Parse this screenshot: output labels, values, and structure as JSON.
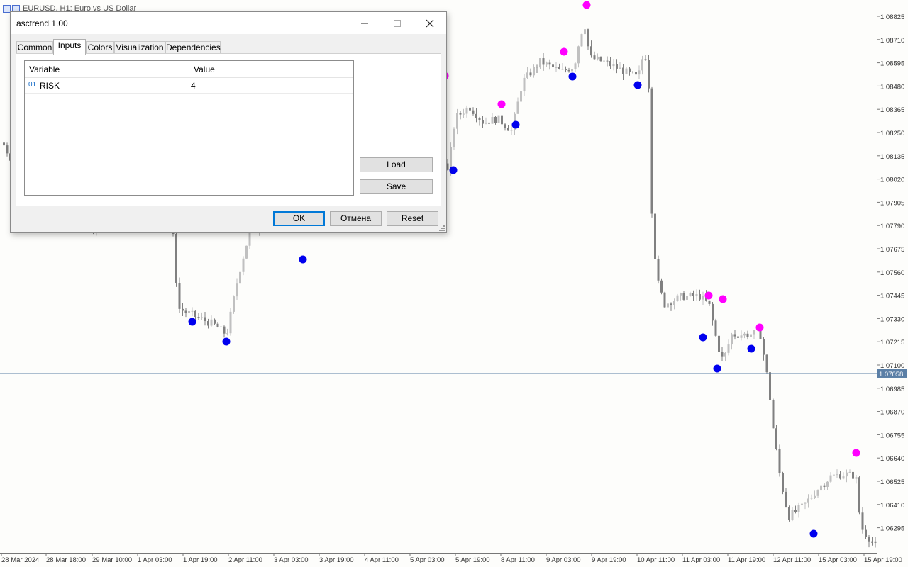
{
  "chart": {
    "title": "EURUSD, H1:  Euro vs US Dollar",
    "price_labels": [
      "1.08825",
      "1.08710",
      "1.08595",
      "1.08480",
      "1.08365",
      "1.08250",
      "1.08135",
      "1.08020",
      "1.07905",
      "1.07790",
      "1.07675",
      "1.07560",
      "1.07445",
      "1.07330",
      "1.07215",
      "1.07100",
      "1.06985",
      "1.06870",
      "1.06755",
      "1.06640",
      "1.06525",
      "1.06410",
      "1.06295"
    ],
    "current_price": "1.07058",
    "time_labels": [
      "28 Mar 2024",
      "28 Mar 18:00",
      "29 Mar 10:00",
      "1 Apr 03:00",
      "1 Apr 19:00",
      "2 Apr 11:00",
      "3 Apr 03:00",
      "3 Apr 19:00",
      "4 Apr 11:00",
      "5 Apr 03:00",
      "5 Apr 19:00",
      "8 Apr 11:00",
      "9 Apr 03:00",
      "9 Apr 19:00",
      "10 Apr 11:00",
      "11 Apr 03:00",
      "11 Apr 19:00",
      "12 Apr 11:00",
      "15 Apr 03:00",
      "15 Apr 19:00"
    ],
    "colors": {
      "candle_up": "#c0c0c0",
      "candle_down": "#808080",
      "dot_up": "#0000ee",
      "dot_down": "#ff00ff",
      "current_line": "#5b7fa6"
    }
  },
  "dialog": {
    "title": "asctrend 1.00",
    "minimize_icon": "minimize-icon",
    "maximize_icon": "maximize-icon",
    "close_icon": "close-icon",
    "tabs": [
      "Common",
      "Inputs",
      "Colors",
      "Visualization",
      "Dependencies"
    ],
    "active_tab": "Inputs",
    "grid": {
      "col_variable": "Variable",
      "col_value": "Value",
      "rows": [
        {
          "type_icon": "01",
          "name": "RISK",
          "value": "4"
        }
      ]
    },
    "load_label": "Load",
    "save_label": "Save",
    "ok_label": "OK",
    "cancel_label": "Отмена",
    "reset_label": "Reset"
  }
}
